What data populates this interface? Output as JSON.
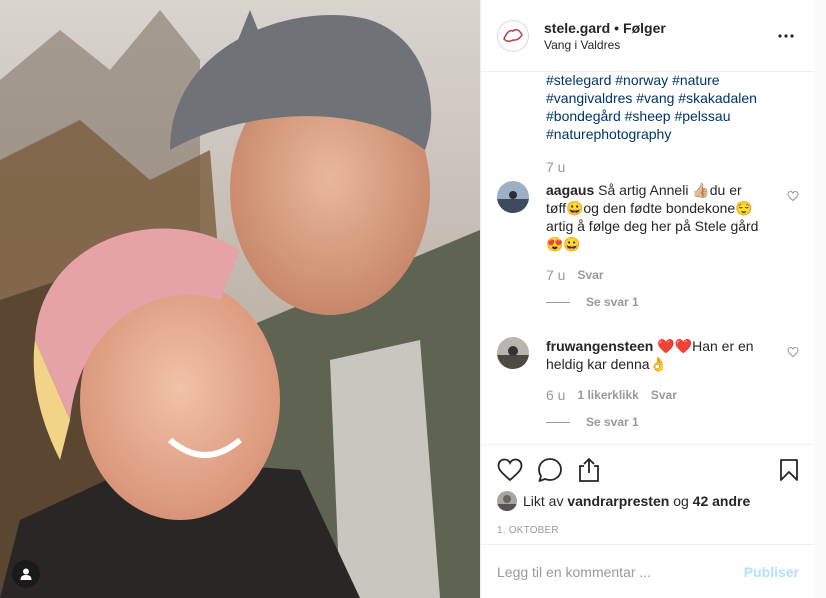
{
  "post": {
    "username": "stele.gard",
    "separator": "•",
    "follow_label": "Følger",
    "location": "Vang i Valdres"
  },
  "caption": {
    "hashtags": [
      "#stelegard #norway #nature",
      "#vangivaldres #vang #skakadalen",
      "#bondegård #sheep #pelssau",
      "#naturephotography"
    ],
    "time": "7 u"
  },
  "comments": [
    {
      "user": "aagaus",
      "text_lines": [
        "Så artig Anneli 👍🏼du er",
        "tøff😀og den fødte bondekone😌",
        "artig å følge deg her på Stele gård",
        "😍😀"
      ],
      "time": "7 u",
      "reply_label": "Svar",
      "likes_label": "",
      "see_replies": "Se svar 1"
    },
    {
      "user": "fruwangensteen",
      "text_lines": [
        "❤️❤️Han er en",
        "heldig kar denna👌"
      ],
      "time": "6 u",
      "reply_label": "Svar",
      "likes_label": "1 likerklikk",
      "see_replies": "Se svar 1"
    }
  ],
  "likes": {
    "prefix": "Likt av",
    "user": "vandrarpresten",
    "middle": "og",
    "count": "42 andre"
  },
  "date": "1. OKTOBER",
  "comment_box": {
    "placeholder": "Legg til en kommentar ...",
    "publish_label": "Publiser"
  },
  "colors": {
    "hashtag": "#003569",
    "muted": "#999999",
    "publish_disabled": "#b2dffc",
    "heart_red": "#ed4956"
  },
  "icons": [
    "user-tag-icon",
    "more-options-icon",
    "heart-icon",
    "comment-icon",
    "share-icon",
    "bookmark-icon"
  ]
}
